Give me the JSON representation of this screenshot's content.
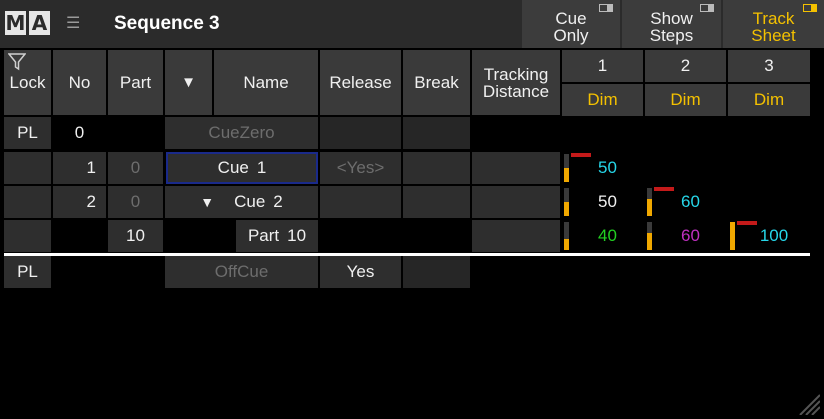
{
  "app": {
    "logo_left": "M",
    "logo_right": "A",
    "title": "Sequence 3"
  },
  "toolbar": {
    "cue_only": {
      "line1": "Cue",
      "line2": "Only",
      "active": false
    },
    "show_steps": {
      "line1": "Show",
      "line2": "Steps",
      "active": false
    },
    "track_sheet": {
      "line1": "Track",
      "line2": "Sheet",
      "active": true
    }
  },
  "headers": {
    "lock": "Lock",
    "no": "No",
    "part": "Part",
    "sort": "▼",
    "name": "Name",
    "release": "Release",
    "break": "Break",
    "tracking_line1": "Tracking",
    "tracking_line2": "Distance"
  },
  "fixtures": [
    {
      "id": "1",
      "attribute": "Dim"
    },
    {
      "id": "2",
      "attribute": "Dim"
    },
    {
      "id": "3",
      "attribute": "Dim"
    }
  ],
  "rows": {
    "cuezero": {
      "lock": "PL",
      "no": "0",
      "name": "CueZero"
    },
    "cue1": {
      "no": "1",
      "part": "0",
      "name_prefix": "Cue",
      "name_num": "1",
      "release": "<Yes>",
      "values": [
        "50"
      ],
      "levels": [
        0.5
      ]
    },
    "cue2": {
      "no": "2",
      "part": "0",
      "expander": "▼",
      "name_prefix": "Cue",
      "name_num": "2",
      "values": [
        "50",
        "60"
      ],
      "levels": [
        0.5,
        0.6
      ]
    },
    "part10": {
      "part": "10",
      "name_prefix": "Part",
      "name_num": "10",
      "values": [
        "40",
        "60",
        "100"
      ],
      "levels": [
        0.4,
        0.6,
        1.0
      ]
    },
    "offcue": {
      "lock": "PL",
      "name": "OffCue",
      "release": "Yes"
    }
  },
  "colors": {
    "accent": "#f4c100",
    "cyan": "#26d6e8",
    "white": "#f0f0f0",
    "green": "#22d022",
    "magenta": "#c030c0",
    "tracked_cyan": "#26d6e8",
    "bar_orange": "#f0a800",
    "red": "#c41a1a"
  }
}
